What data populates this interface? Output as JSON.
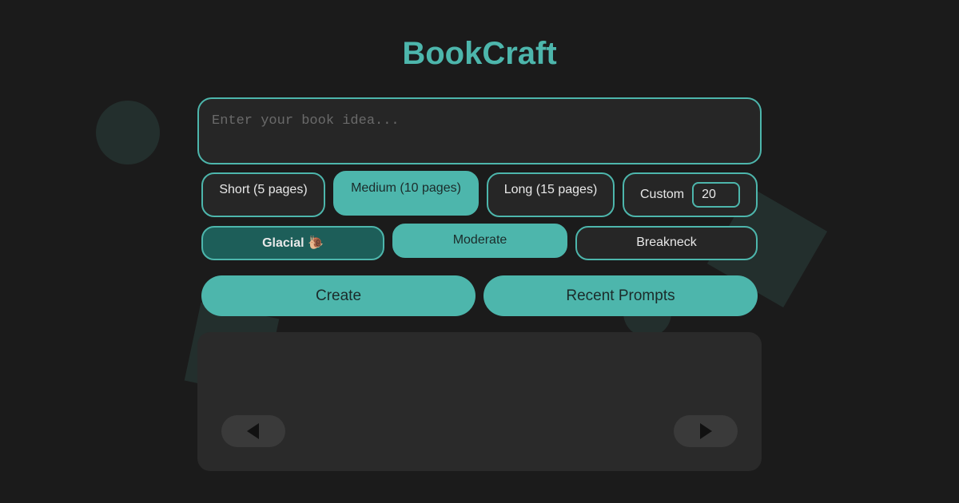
{
  "app": {
    "title": "BookCraft"
  },
  "idea_input": {
    "placeholder": "Enter your book idea...",
    "value": ""
  },
  "length_options": {
    "short_label": "Short (5 pages)",
    "medium_label": "Medium (10 pages)",
    "long_label": "Long (15 pages)",
    "custom_label": "Custom",
    "custom_value": "20",
    "selected": "medium"
  },
  "speed_options": {
    "glacial_label": "Glacial 🐌",
    "moderate_label": "Moderate",
    "breakneck_label": "Breakneck",
    "selected": "moderate"
  },
  "actions": {
    "create_label": "Create",
    "recent_label": "Recent Prompts"
  },
  "pager": {
    "prev_icon": "triangle-left-icon",
    "next_icon": "triangle-right-icon"
  },
  "colors": {
    "accent": "#4db6ac",
    "background": "#1b1b1b",
    "panel": "#2a2a2a",
    "glacial_bg": "#1d5e59"
  }
}
